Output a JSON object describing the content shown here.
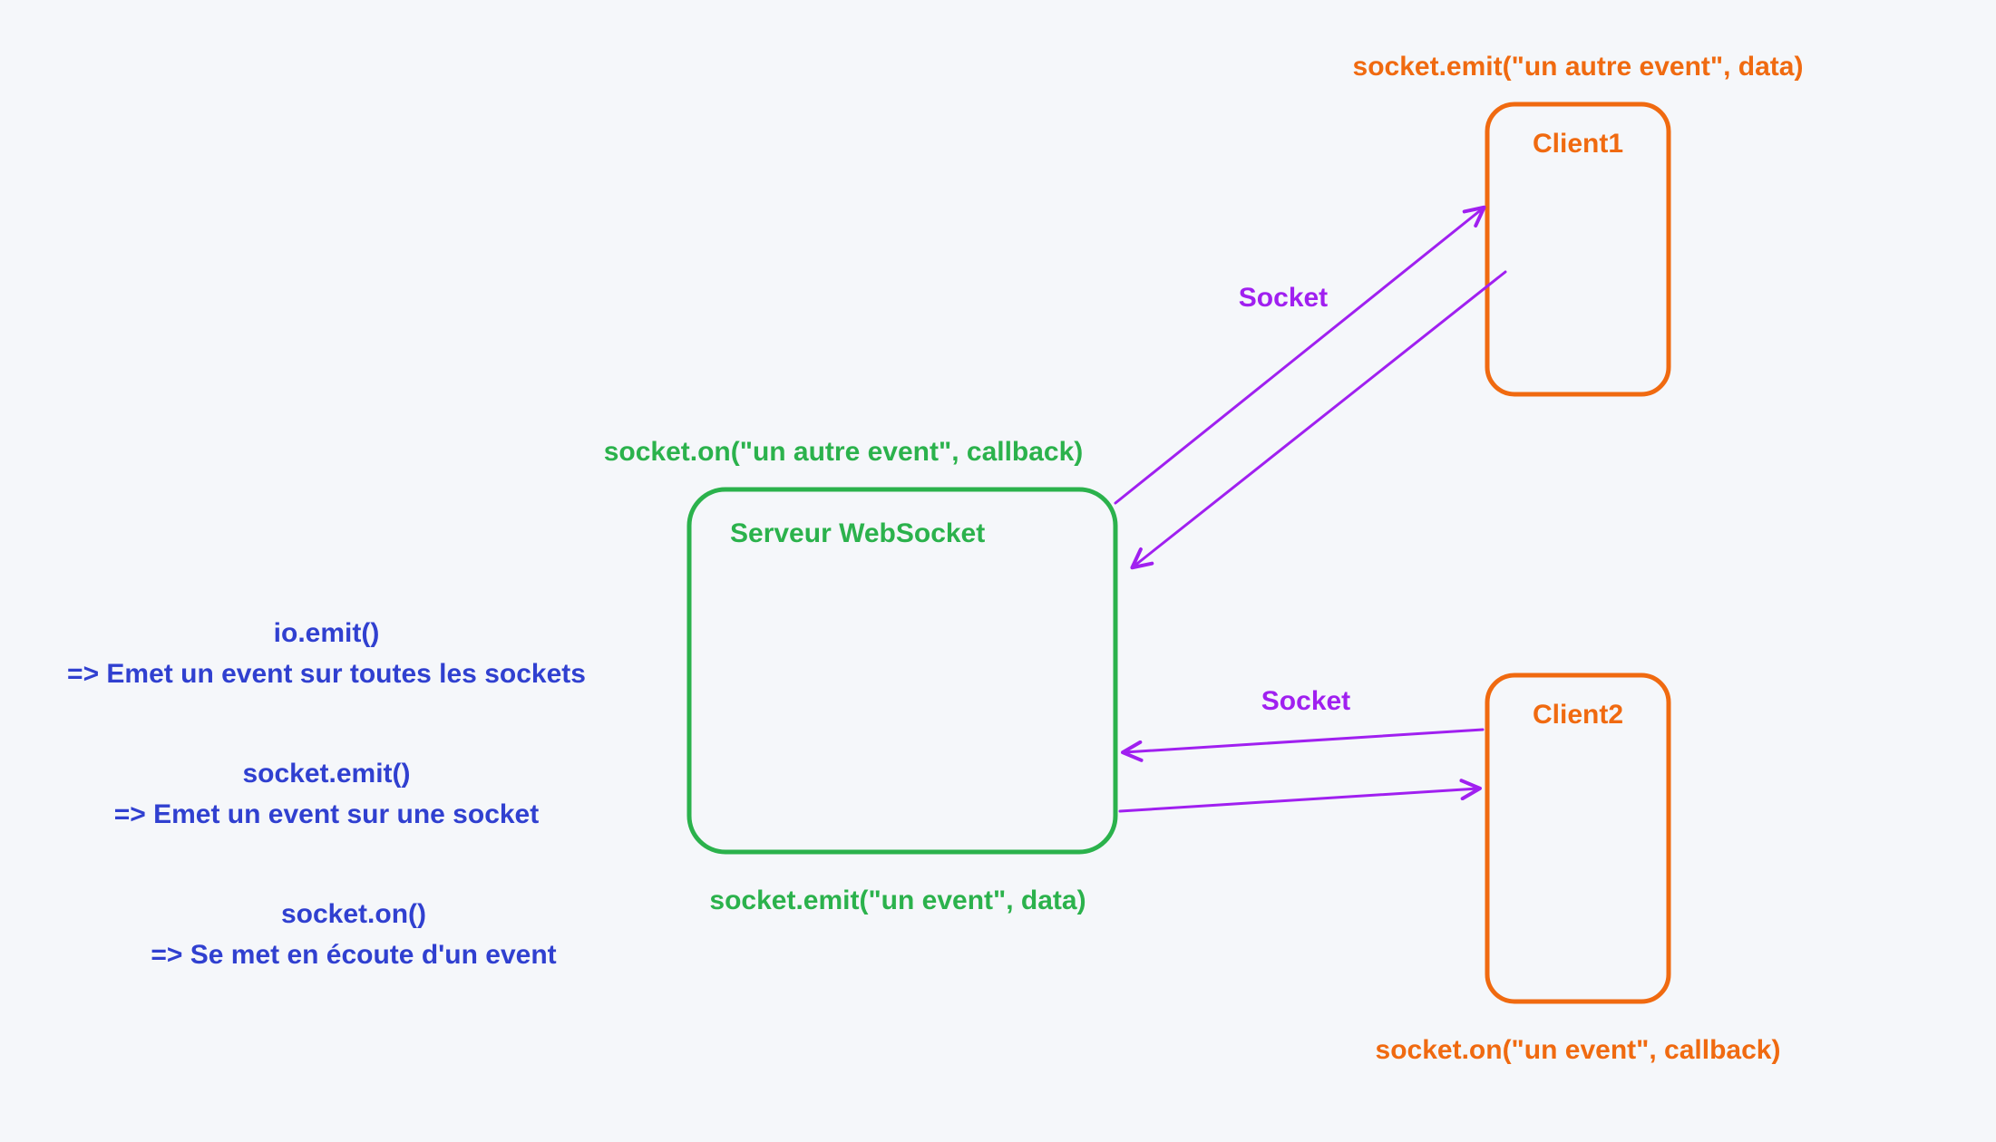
{
  "colors": {
    "green": "#2bb24c",
    "orange": "#f06a10",
    "purple": "#a020f0",
    "blue": "#3040d0",
    "bg": "#f5f7fa"
  },
  "server": {
    "label": "Serveur WebSocket",
    "top_caption": "socket.on(\"un autre event\", callback)",
    "bottom_caption": "socket.emit(\"un event\", data)"
  },
  "client1": {
    "label": "Client1",
    "caption": "socket.emit(\"un autre event\", data)",
    "socket_label": "Socket"
  },
  "client2": {
    "label": "Client2",
    "caption": "socket.on(\"un event\", callback)",
    "socket_label": "Socket"
  },
  "notes": {
    "n1a": "io.emit()",
    "n1b": "=> Emet un event sur toutes les sockets",
    "n2a": "socket.emit()",
    "n2b": "=> Emet un event sur une socket",
    "n3a": "socket.on()",
    "n3b": "=> Se met en écoute d'un event"
  }
}
